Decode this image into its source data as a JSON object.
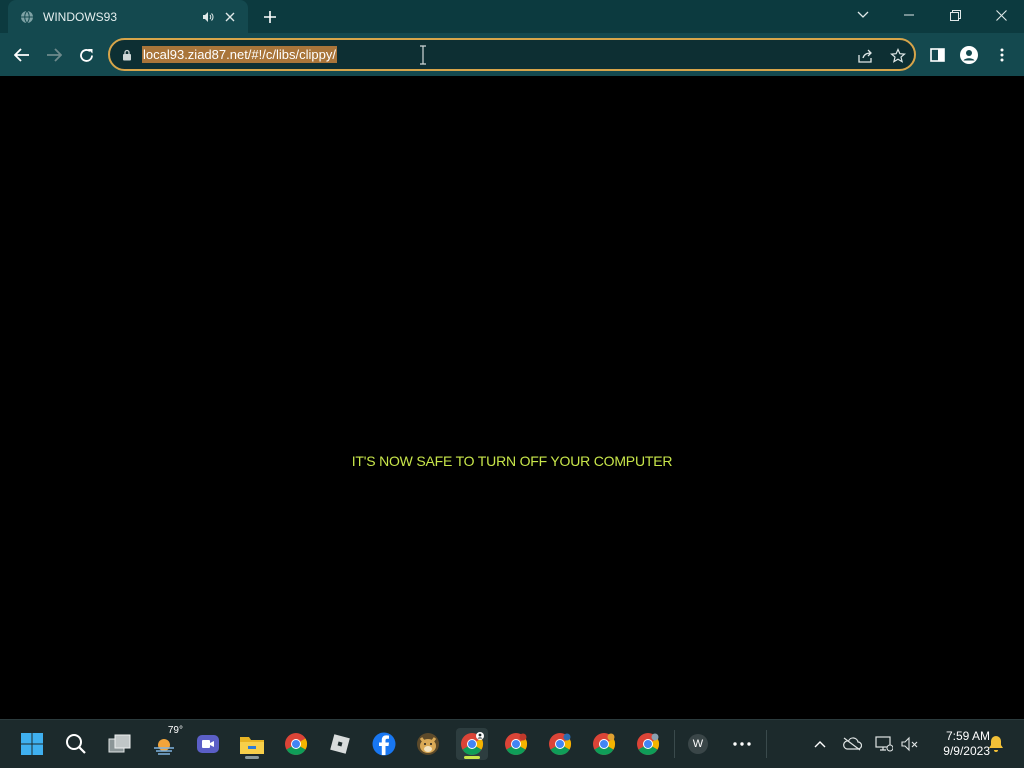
{
  "browser": {
    "tab_title": "WINDOWS93",
    "url": "local93.ziad87.net/#!/c/libs/clippy/"
  },
  "page": {
    "message": "IT'S NOW SAFE TO TURN OFF YOUR COMPUTER",
    "message_color": "#c8e64a",
    "background": "#000000"
  },
  "taskbar": {
    "weather_temp": "79°",
    "word_label": "W",
    "clock_time": "7:59 AM",
    "clock_date": "9/9/2023",
    "icons": [
      "windows-start-icon",
      "search-icon",
      "task-view-icon",
      "weather-icon",
      "video-call-icon",
      "file-explorer-icon",
      "chrome-icon",
      "roblox-icon",
      "facebook-icon",
      "doge-icon",
      "chrome-profile-icon",
      "chrome-icon",
      "chrome-icon",
      "chrome-icon",
      "chrome-icon",
      "word-icon",
      "more-icon"
    ]
  }
}
